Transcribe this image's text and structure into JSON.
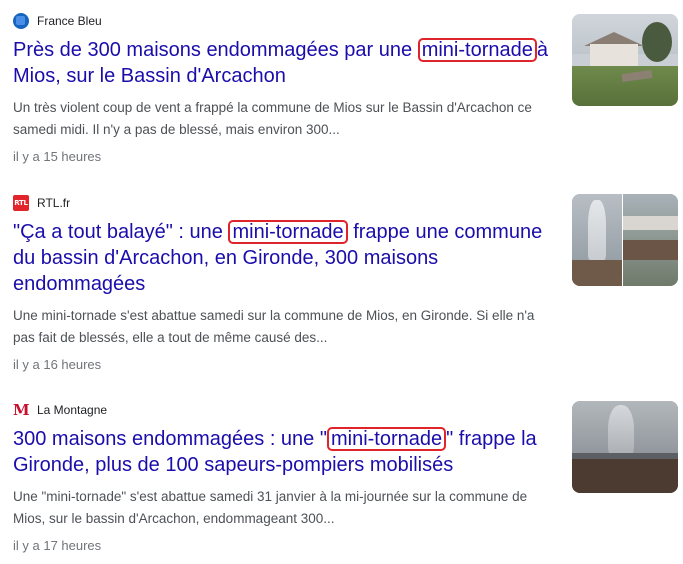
{
  "articles": [
    {
      "source": {
        "name": "France Bleu",
        "logo_icon": "france-bleu-logo-icon",
        "logo_color": "#1565c0"
      },
      "headline": {
        "before": "Près de 300 maisons endommagées par une",
        "highlight": "mini-tornade",
        "after": "à Mios, sur le Bassin d'Arcachon"
      },
      "snippet": "Un très violent coup de vent a frappé la commune de Mios sur le Bassin d'Arcachon ce samedi midi. Il n'y a pas de blessé, mais environ 300...",
      "time": "il y a 15 heures"
    },
    {
      "source": {
        "name": "RTL.fr",
        "logo_text": "RTL",
        "logo_icon": "rtl-logo-icon",
        "logo_color": "#e1252b"
      },
      "headline": {
        "before": "\"Ça a tout balayé\" : une",
        "highlight": "mini-tornade",
        "after": "frappe une commune du bassin d'Arcachon, en Gironde, 300 maisons endommagées"
      },
      "snippet": "Une mini-tornade s'est abattue samedi sur la commune de Mios, en Gironde. Si elle n'a pas fait de blessés, elle a tout de même causé des...",
      "time": "il y a 16 heures"
    },
    {
      "source": {
        "name": "La Montagne",
        "logo_text": "M",
        "logo_icon": "la-montagne-logo-icon",
        "logo_color": "#c8102e"
      },
      "headline": {
        "before": "300 maisons endommagées : une \"",
        "highlight": "mini-tornade",
        "after": "\" frappe la Gironde, plus de 100 sapeurs-pompiers mobilisés"
      },
      "snippet": "Une \"mini-tornade\" s'est abattue samedi 31 janvier à la mi-journée sur la commune de Mios, sur le bassin d'Arcachon, endommageant 300...",
      "time": "il y a 17 heures"
    }
  ],
  "colors": {
    "headline_link": "#1a0dab",
    "highlight_box": "#e0242b",
    "snippet_text": "#4d5156",
    "timestamp_text": "#70757a"
  }
}
